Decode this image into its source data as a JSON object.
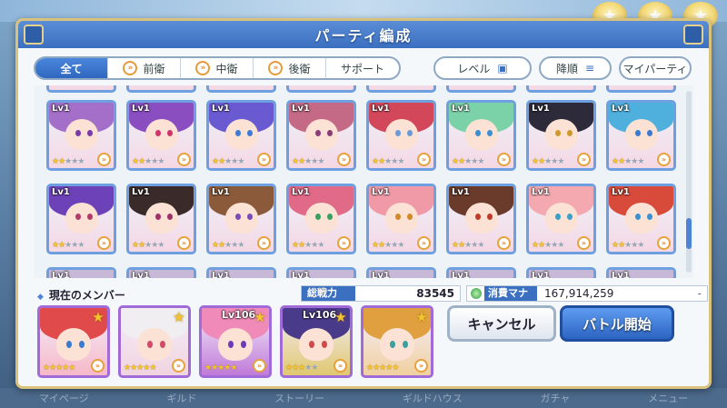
{
  "dialog": {
    "title": "パーティ編成"
  },
  "filters": {
    "tabs": [
      {
        "label": "全て",
        "icon": ""
      },
      {
        "label": "前衛",
        "icon": "position-icon"
      },
      {
        "label": "中衛",
        "icon": "position-icon"
      },
      {
        "label": "後衛",
        "icon": "position-icon"
      },
      {
        "label": "サポート",
        "icon": ""
      }
    ],
    "active_tab": "全て"
  },
  "sort": {
    "level_label": "レベル",
    "order_label": "降順",
    "my_party_label": "マイパーティ"
  },
  "characters": {
    "row1": [
      {
        "lv": "Lv1",
        "stars": 2,
        "hair": "#a46fc9",
        "eyes": "#7a3aa8"
      },
      {
        "lv": "Lv1",
        "stars": 2,
        "hair": "#8a4ec0",
        "eyes": "#d0346a"
      },
      {
        "lv": "Lv1",
        "stars": 2,
        "hair": "#6a5ad1",
        "eyes": "#3c7bd8"
      },
      {
        "lv": "Lv1",
        "stars": 2,
        "hair": "#c46a86",
        "eyes": "#8b3c7a"
      },
      {
        "lv": "Lv1",
        "stars": 2,
        "hair": "#d2485a",
        "eyes": "#6a9ad8"
      },
      {
        "lv": "Lv1",
        "stars": 2,
        "hair": "#7bd2a8",
        "eyes": "#3b8fd0"
      },
      {
        "lv": "Lv1",
        "stars": 2,
        "hair": "#2d2a3a",
        "eyes": "#d09a2a"
      },
      {
        "lv": "Lv1",
        "stars": 2,
        "hair": "#4fb0de",
        "eyes": "#3b7ad0"
      }
    ],
    "row2": [
      {
        "lv": "Lv1",
        "stars": 2,
        "hair": "#6d42b8",
        "eyes": "#b23a6a"
      },
      {
        "lv": "Lv1",
        "stars": 2,
        "hair": "#3a2a2a",
        "eyes": "#a0306a"
      },
      {
        "lv": "Lv1",
        "stars": 2,
        "hair": "#8a5a3a",
        "eyes": "#7a4ab8"
      },
      {
        "lv": "Lv1",
        "stars": 2,
        "hair": "#e06a88",
        "eyes": "#3aa060"
      },
      {
        "lv": "Lv1",
        "stars": 2,
        "hair": "#f09aa8",
        "eyes": "#d08a2a"
      },
      {
        "lv": "Lv1",
        "stars": 2,
        "hair": "#6a3a2a",
        "eyes": "#c03a2a"
      },
      {
        "lv": "Lv1",
        "stars": 2,
        "hair": "#f4a8b0",
        "eyes": "#3aa0c8"
      },
      {
        "lv": "Lv1",
        "stars": 2,
        "hair": "#d84a3a",
        "eyes": "#3a90d0"
      }
    ],
    "row3_levels": [
      "Lv1",
      "Lv1",
      "Lv1",
      "Lv1",
      "Lv1",
      "Lv1",
      "Lv1",
      "Lv1"
    ]
  },
  "members_section": {
    "label": "現在のメンバー",
    "power_label": "総戦力",
    "power_value": "83545",
    "mana_label": "消費マナ",
    "mana_value": "167,914,259",
    "mana_suffix": "-"
  },
  "members": [
    {
      "lv": "",
      "stars": 5,
      "hair": "#e04a4a",
      "eyes": "#3a7ad0",
      "bg": "#f6b8c8"
    },
    {
      "lv": "",
      "stars": 5,
      "hair": "#f0eef0",
      "eyes": "#d04a6a",
      "bg": "#f0d4e0"
    },
    {
      "lv": "Lv106",
      "stars": 5,
      "hair": "#f08ab8",
      "eyes": "#6a3ab8",
      "bg": "#c07ad8"
    },
    {
      "lv": "Lv106",
      "stars": 3,
      "hair": "#4a3a8a",
      "eyes": "#d04a4a",
      "bg": "#e0c870"
    },
    {
      "lv": "",
      "stars": 5,
      "hair": "#e0a040",
      "eyes": "#3aa0a0",
      "bg": "#f0d0a0"
    }
  ],
  "buttons": {
    "cancel": "キャンセル",
    "start": "バトル開始"
  },
  "background_tabs": [
    "マイページ",
    "ギルド",
    "ストーリー",
    "ギルドハウス",
    "ガチャ",
    "メニュー"
  ],
  "colors": {
    "accent_blue": "#3b6fc0",
    "card_border": "#6e9fe0",
    "member_border": "#a06ad8",
    "gold": "#d8c27c"
  }
}
